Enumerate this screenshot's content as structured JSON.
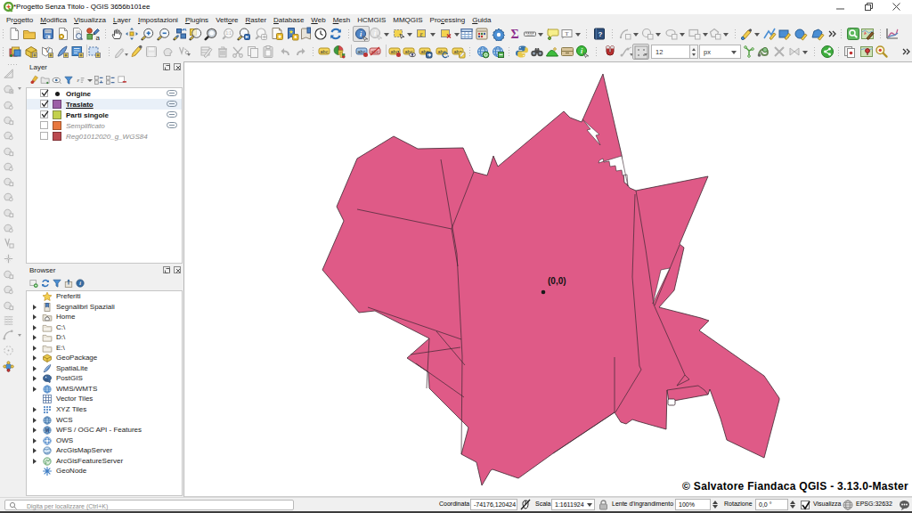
{
  "window": {
    "title": "*Progetto Senza Titolo - QGIS 3656b101ee",
    "controls": [
      "minimize",
      "maximize",
      "close"
    ]
  },
  "menubar": {
    "items": [
      {
        "label": "Progetto",
        "mnemonic": 2
      },
      {
        "label": "Modifica",
        "mnemonic": 0
      },
      {
        "label": "Visualizza",
        "mnemonic": 0
      },
      {
        "label": "Layer",
        "mnemonic": 0
      },
      {
        "label": "Impostazioni",
        "mnemonic": 0
      },
      {
        "label": "Plugins",
        "mnemonic": 0
      },
      {
        "label": "Vettore",
        "mnemonic": 4
      },
      {
        "label": "Raster",
        "mnemonic": 0
      },
      {
        "label": "Database",
        "mnemonic": 0
      },
      {
        "label": "Web",
        "mnemonic": 0
      },
      {
        "label": "Mesh",
        "mnemonic": 0
      },
      {
        "label": "HCMGIS",
        "mnemonic": -1
      },
      {
        "label": "MMQGIS",
        "mnemonic": -1
      },
      {
        "label": "Processing",
        "mnemonic": 3
      },
      {
        "label": "Guida",
        "mnemonic": 0
      }
    ]
  },
  "toolbar1": {
    "items": [
      {
        "name": "new-project",
        "icon": "page"
      },
      {
        "name": "open-project",
        "icon": "folder"
      },
      {
        "name": "save-project",
        "icon": "floppy"
      },
      {
        "name": "new-print-layout",
        "icon": "layout"
      },
      {
        "name": "show-layout-manager",
        "icon": "layoutmgr"
      },
      {
        "name": "style-manager",
        "icon": "stylemgr",
        "sep_after": true
      },
      {
        "name": "pan-map",
        "icon": "hand"
      },
      {
        "name": "pan-to-selection",
        "icon": "panselect"
      },
      {
        "name": "zoom-in",
        "icon": "zoomin"
      },
      {
        "name": "zoom-out",
        "icon": "zoomout"
      },
      {
        "name": "zoom-full",
        "icon": "zoomfull"
      },
      {
        "name": "zoom-to-selection",
        "icon": "zoomselect"
      },
      {
        "name": "zoom-to-layer",
        "icon": "zoomlayer"
      },
      {
        "name": "zoom-native",
        "icon": "zoomnative",
        "disabled": true
      },
      {
        "name": "zoom-last",
        "icon": "zoomlast"
      },
      {
        "name": "zoom-next",
        "icon": "zoomnext",
        "disabled": true
      },
      {
        "name": "new-spatial-bookmark",
        "icon": "bookmarknew"
      },
      {
        "name": "show-spatial-bookmarks",
        "icon": "bookmarkshow"
      },
      {
        "name": "spatial-bookmarks-manager",
        "icon": "bookmarkmgr"
      },
      {
        "name": "temporal-controller",
        "icon": "clock"
      },
      {
        "name": "refresh-map",
        "icon": "refresh",
        "sep_after": true
      },
      {
        "name": "identify-features",
        "icon": "identify",
        "active": true
      },
      {
        "name": "run-feature-action",
        "icon": "actionrun",
        "disabled": true,
        "dropdown": true
      },
      {
        "name": "select-features",
        "icon": "selectrect",
        "dropdown": true
      },
      {
        "name": "select-by-expression",
        "icon": "selectexpr",
        "dropdown": true
      },
      {
        "name": "deselect-features",
        "icon": "deselect",
        "dropdown": true
      },
      {
        "name": "open-attribute-table",
        "icon": "attrtable"
      },
      {
        "name": "field-calculator",
        "icon": "fieldcalc"
      },
      {
        "name": "processing-toolbox",
        "icon": "gearblue"
      },
      {
        "name": "statistical-summary",
        "icon": "sigma"
      },
      {
        "name": "measure",
        "icon": "ruler",
        "dropdown": true
      },
      {
        "name": "map-tips",
        "icon": "maptip"
      },
      {
        "name": "text-annotation",
        "icon": "textannot",
        "dropdown": true,
        "sep_after": true
      },
      {
        "name": "help-contents",
        "icon": "helpbook",
        "sep_after": true
      },
      {
        "name": "rotate-feature",
        "icon": "grayarc",
        "disabled": true,
        "dropdown": true
      },
      {
        "name": "move-feature",
        "icon": "graycircle",
        "disabled": true,
        "dropdown": true
      },
      {
        "name": "copy-move-feature",
        "icon": "graycloud",
        "disabled": true,
        "dropdown": true
      },
      {
        "name": "offset-curve",
        "icon": "grayrect",
        "disabled": true,
        "dropdown": true
      },
      {
        "name": "reshape-features",
        "icon": "graypenta",
        "disabled": true,
        "dropdown": true,
        "sep_after": true
      },
      {
        "name": "annotation-point",
        "icon": "annpoint",
        "dropdown": true
      },
      {
        "name": "annotation-line",
        "icon": "annline"
      },
      {
        "name": "annotation-rectangle",
        "icon": "annrect"
      },
      {
        "name": "annotation-ellipse",
        "icon": "anncircle"
      },
      {
        "name": "annotation-polygon",
        "icon": "annpoly"
      },
      {
        "name": "toolbar-overflow",
        "icon": "chevrons",
        "sep_after": true
      },
      {
        "name": "osm-place-search",
        "icon": "greensearch"
      },
      {
        "name": "qgis2web",
        "icon": "mapedit",
        "sep_after": true
      },
      {
        "name": "data-plotly",
        "icon": "chartline"
      }
    ]
  },
  "toolbar2": {
    "size_value": "12",
    "unit_value": "px",
    "items": [
      {
        "name": "data-source-manager",
        "icon": "dsm"
      },
      {
        "name": "new-geopackage-layer",
        "icon": "geopackagenew"
      },
      {
        "name": "new-shapefile-layer",
        "icon": "shapefilenew"
      },
      {
        "name": "new-spatialite-layer",
        "icon": "spatialitenew"
      },
      {
        "name": "new-memory-layer",
        "icon": "memorynew"
      },
      {
        "name": "new-virtual-layer",
        "icon": "virtualnew"
      },
      {
        "name": "current-edits",
        "icon": "editsgray",
        "disabled": true,
        "dropdown": "sub"
      },
      {
        "name": "toggle-editing",
        "icon": "pencil"
      },
      {
        "name": "save-layer-edits",
        "icon": "floppygray",
        "disabled": true
      },
      {
        "name": "add-feature",
        "icon": "grayblob",
        "disabled": true
      },
      {
        "name": "vertex-tool",
        "icon": "grayvx",
        "disabled": true,
        "dropdown": "sub"
      },
      {
        "name": "modify-attributes",
        "icon": "graytablepen",
        "disabled": true
      },
      {
        "name": "delete-selected",
        "icon": "trashgray",
        "disabled": true
      },
      {
        "name": "cut-features",
        "icon": "scissors",
        "disabled": true
      },
      {
        "name": "copy-features",
        "icon": "copygray",
        "disabled": true
      },
      {
        "name": "paste-features",
        "icon": "pastegray",
        "disabled": true
      },
      {
        "name": "undo",
        "icon": "undogray",
        "disabled": true
      },
      {
        "name": "redo",
        "icon": "redogray",
        "disabled": true,
        "sep_after": true
      },
      {
        "name": "layer-labeling-options",
        "icon": "abctag"
      },
      {
        "name": "layer-diagram-options",
        "icon": "pie",
        "sep_after": "line"
      },
      {
        "name": "highlight-pinned-labels",
        "icon": "abcblue"
      },
      {
        "name": "show-unplaced-labels",
        "icon": "abcred",
        "sep_after": "line"
      },
      {
        "name": "pin-unpin-labels",
        "icon": "abcpin"
      },
      {
        "name": "show-hide-labels",
        "icon": "abceye"
      },
      {
        "name": "move-label",
        "icon": "abcmove"
      },
      {
        "name": "rotate-label",
        "icon": "abcrotate"
      },
      {
        "name": "change-label",
        "icon": "abcchange",
        "sep_after": true
      },
      {
        "name": "metasearch",
        "icon": "globegreen"
      },
      {
        "name": "metasearch-services",
        "icon": "globegreen2",
        "sep_after": true
      },
      {
        "name": "python-console",
        "icon": "python"
      },
      {
        "name": "search-plugins",
        "icon": "binoculars"
      },
      {
        "name": "terrain-shading",
        "icon": "mound"
      },
      {
        "name": "archive-plugin",
        "icon": "drawer"
      },
      {
        "name": "info-tool-plugin",
        "icon": "infogreen",
        "sep_after": true
      },
      {
        "name": "enable-snapping",
        "icon": "magnet"
      },
      {
        "name": "enable-tracing",
        "icon": "tracing",
        "disabled": true,
        "dropdown": "sub"
      },
      {
        "name": "self-intersection-grid",
        "icon": "dotgrid",
        "active": true,
        "dropdown": "sub"
      },
      {
        "name": "snapping-tolerance-spin",
        "icon": "spinbox",
        "widget": "spin"
      },
      {
        "name": "snapping-unit-combo",
        "icon": "combounit",
        "widget": "combo"
      },
      {
        "name": "topology-node",
        "icon": "greennode"
      },
      {
        "name": "topology-curve",
        "icon": "greencurl"
      },
      {
        "name": "clear-tool",
        "icon": "grayx",
        "disabled": true
      },
      {
        "name": "bowtie-tool",
        "icon": "graybow",
        "disabled": true,
        "dropdown": true,
        "sep_after": true
      },
      {
        "name": "share-plugin",
        "icon": "sharegreen",
        "sep_after": true
      },
      {
        "name": "copy-style",
        "icon": "copystyle"
      },
      {
        "name": "georeferencer",
        "icon": "mappin"
      },
      {
        "name": "zoom-level-plugin",
        "icon": "magred"
      },
      {
        "name": "toolbar2-overflow",
        "icon": "chevrons"
      }
    ]
  },
  "left_toolbar": {
    "items": [
      {
        "name": "cad-tools",
        "icon": "cadgray"
      },
      {
        "name": "add-feature",
        "icon": "blobdd",
        "dropdown": true
      },
      {
        "name": "move-feature-copy",
        "icon": "blob1"
      },
      {
        "name": "circle-2points",
        "icon": "blob2"
      },
      {
        "name": "circle-3points",
        "icon": "blob1"
      },
      {
        "name": "ellipse-center",
        "icon": "blob2"
      },
      {
        "name": "rectangle-extent",
        "icon": "blob1"
      },
      {
        "name": "regular-polygon",
        "icon": "blob2"
      },
      {
        "name": "circular-string",
        "icon": "blob1"
      },
      {
        "name": "fill-ring",
        "icon": "blob2"
      },
      {
        "name": "offset-point",
        "icon": "blob1"
      },
      {
        "name": "reshape",
        "icon": "vsquare"
      },
      {
        "name": "split-features",
        "icon": "plusgray"
      },
      {
        "name": "merge-features",
        "icon": "blob2"
      },
      {
        "name": "rotate-point",
        "icon": "blob1"
      },
      {
        "name": "simplify-feature",
        "icon": "blob2"
      },
      {
        "name": "grid-tool",
        "icon": "gridgray"
      },
      {
        "name": "arc-tool",
        "icon": "arcdd",
        "dropdown": true
      },
      {
        "name": "dotted-circle",
        "icon": "dotcircle"
      },
      {
        "name": "vertex-editor",
        "icon": "vertexcolor"
      }
    ]
  },
  "layer_panel": {
    "title": "Layer",
    "toolbar": [
      {
        "name": "open-layer-styling",
        "icon": "stylingbrush"
      },
      {
        "name": "add-group",
        "icon": "addgroup"
      },
      {
        "name": "manage-map-themes",
        "icon": "themeeye"
      },
      {
        "name": "filter-legend",
        "icon": "funnelblue"
      },
      {
        "name": "filter-by-expression",
        "icon": "exprfilter",
        "dropdown": true
      },
      {
        "name": "expand-all",
        "icon": "expandall"
      },
      {
        "name": "collapse-all",
        "icon": "collapseall"
      },
      {
        "name": "remove-layer",
        "icon": "removelayer"
      }
    ],
    "layers": [
      {
        "name": "Origine",
        "checked": true,
        "swatch": "point",
        "color": "#1a1a1a",
        "bold": true,
        "indicator": true
      },
      {
        "name": "Traslato",
        "checked": true,
        "swatch": "square",
        "color": "#9c5fa7",
        "border": "#6d4275",
        "bold": true,
        "selected": true,
        "current": true,
        "indicator": true
      },
      {
        "name": "Parti singole",
        "checked": true,
        "swatch": "square",
        "color": "#c3d04c",
        "border": "#889144",
        "bold": true,
        "indicator": true
      },
      {
        "name": "Semplificato",
        "checked": false,
        "swatch": "square",
        "color": "#e8783f",
        "border": "#a3542c",
        "dim": true,
        "indicator": true
      },
      {
        "name": "Reg01012020_g_WGS84",
        "checked": false,
        "swatch": "square",
        "color": "#bb4a50",
        "border": "#833438",
        "dim": true,
        "indicator": false
      }
    ]
  },
  "browser_panel": {
    "title": "Browser",
    "toolbar": [
      {
        "name": "add-selected-layers",
        "icon": "addselected"
      },
      {
        "name": "refresh-browser",
        "icon": "refreshsmall"
      },
      {
        "name": "filter-browser",
        "icon": "funnelblue"
      },
      {
        "name": "collapse-all-browser",
        "icon": "collapsebox"
      },
      {
        "name": "enable-properties",
        "icon": "infocircle"
      }
    ],
    "items": [
      {
        "label": "Preferiti",
        "icon": "star",
        "expander": false
      },
      {
        "label": "Segnalibri Spaziali",
        "icon": "bookmarkbl",
        "expander": true
      },
      {
        "label": "Home",
        "icon": "homefolder",
        "expander": true
      },
      {
        "label": "C:\\",
        "icon": "folderdrive",
        "expander": true
      },
      {
        "label": "D:\\",
        "icon": "folderdrive",
        "expander": true
      },
      {
        "label": "E:\\",
        "icon": "folderdrive",
        "expander": true
      },
      {
        "label": "GeoPackage",
        "icon": "geopackage",
        "expander": true
      },
      {
        "label": "SpatiaLite",
        "icon": "spatialite",
        "expander": true
      },
      {
        "label": "PostGIS",
        "icon": "postgis",
        "expander": true
      },
      {
        "label": "WMS/WMTS",
        "icon": "wms",
        "expander": true
      },
      {
        "label": "Vector Tiles",
        "icon": "vectortiles",
        "expander": false
      },
      {
        "label": "XYZ Tiles",
        "icon": "xyztiles",
        "expander": true
      },
      {
        "label": "WCS",
        "icon": "wcs",
        "expander": true
      },
      {
        "label": "WFS / OGC API - Features",
        "icon": "wfs",
        "expander": true
      },
      {
        "label": "OWS",
        "icon": "ows",
        "expander": true
      },
      {
        "label": "ArcGisMapServer",
        "icon": "arcgismap",
        "expander": true
      },
      {
        "label": "ArcGisFeatureServer",
        "icon": "arcgisfeat",
        "expander": true
      },
      {
        "label": "GeoNode",
        "icon": "geonode",
        "expander": false
      }
    ]
  },
  "map": {
    "origin_label": "(0,0)",
    "attribution": "© Salvatore Fiandaca QGIS - 3.13.0-Master",
    "fill_color": "#df5a87",
    "stroke_color": "#3b2630"
  },
  "statusbar": {
    "search_placeholder": "Digita per localizzare (Ctrl+K)",
    "coordinate_label": "Coordinata",
    "coordinate_value": "-74176,120424",
    "scale_label": "Scala",
    "scale_value": "1:1611924",
    "magnifier_label": "Lente d'ingrandimento",
    "magnifier_value": "100%",
    "rotation_label": "Rotazione",
    "rotation_value": "0,0 °",
    "render_label": "Visualizza",
    "crs_value": "EPSG:32632"
  }
}
